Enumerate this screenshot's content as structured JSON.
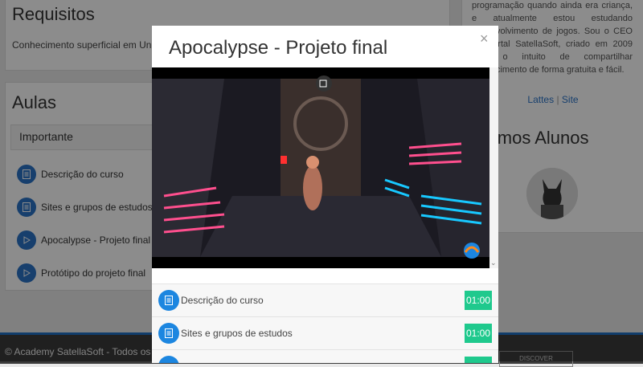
{
  "requisitos": {
    "title": "Requisitos",
    "text": "Conhecimento superficial em Unity"
  },
  "aulas": {
    "title": "Aulas",
    "section": "Importante",
    "lessons": [
      {
        "label": "Descrição do curso",
        "icon": "document-icon"
      },
      {
        "label": "Sites e grupos de estudos",
        "icon": "document-icon"
      },
      {
        "label": "Apocalypse - Projeto final",
        "icon": "play-icon"
      },
      {
        "label": "Protótipo do projeto final",
        "icon": "play-icon"
      }
    ]
  },
  "sidebar": {
    "bio": "programação quando ainda era criança, e atualmente estou estudando desenvolvimento de jogos. Sou o CEO do Portal SatellaSoft, criado em 2009 com o intuito de compartilhar conhecimento de forma gratuita e fácil.",
    "link_lattes": "Lattes",
    "link_separator": "|",
    "link_site": "Site",
    "students_title": "Últimos Alunos"
  },
  "footer": {
    "text": "© Academy SatellaSoft - Todos os Direitos Reservados",
    "button": "DISCOVER"
  },
  "modal": {
    "title": "Apocalypse - Projeto final",
    "close": "×",
    "lessons": [
      {
        "label": "Descrição do curso",
        "duration": "01:00",
        "icon": "document-icon"
      },
      {
        "label": "Sites e grupos de estudos",
        "duration": "01:00",
        "icon": "document-icon"
      },
      {
        "label": "",
        "duration": "",
        "icon": "document-icon"
      }
    ]
  },
  "colors": {
    "accent": "#1c86e0",
    "duration_badge": "#1fc98d",
    "footer": "#3b3b3b"
  }
}
